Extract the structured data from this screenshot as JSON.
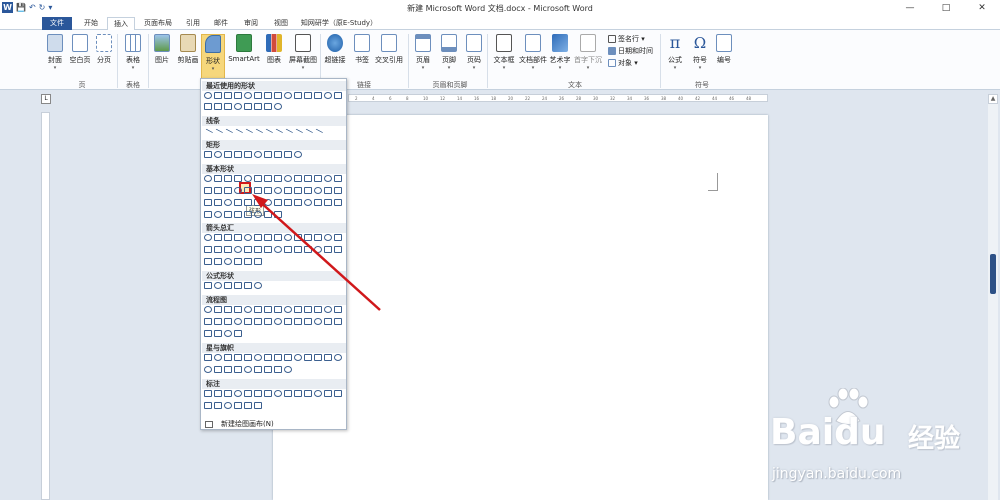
{
  "window": {
    "title": "新建 Microsoft Word 文档.docx - Microsoft Word",
    "minimize": "—",
    "maximize": "□",
    "close": "✕"
  },
  "quick_access": {
    "logo": "W",
    "save": "💾",
    "undo": "↶",
    "redo": "↻",
    "more": "▾"
  },
  "tabs": [
    "文件",
    "开始",
    "插入",
    "页面布局",
    "引用",
    "邮件",
    "审阅",
    "视图",
    "知网研学（原E-Study）"
  ],
  "active_tab": "插入",
  "ribbon": {
    "buttons": {
      "cover": "封面",
      "blank": "空白页",
      "pagebreak": "分页",
      "table": "表格",
      "picture": "图片",
      "clipart": "剪贴画",
      "shapes": "形状",
      "smartart": "SmartArt",
      "chart": "图表",
      "screenshot": "屏幕截图",
      "hyperlink": "超链接",
      "bookmark": "书签",
      "crossref": "交叉引用",
      "header": "页眉",
      "footer": "页脚",
      "pagenum": "页码",
      "textbox": "文本框",
      "docparts": "文档部件",
      "wordart": "艺术字",
      "dropcap": "首字下沉",
      "formula": "公式",
      "symbol": "符号",
      "number": "编号"
    },
    "small": {
      "signature": "签名行",
      "datetime": "日期和时间",
      "object": "对象"
    },
    "groups": {
      "pages": "页",
      "tables": "表格",
      "links": "链接",
      "headerfooter": "页眉和页脚",
      "text": "文本",
      "symbols": "符号"
    }
  },
  "shapes_menu": {
    "sections": [
      "最近使用的形状",
      "线条",
      "矩形",
      "基本形状",
      "箭头总汇",
      "公式形状",
      "流程图",
      "星与旗帜",
      "标注"
    ],
    "tooltip": "弦形",
    "new_canvas": "新建绘图画布(N)"
  },
  "ruler_ticks": [
    "2",
    "4",
    "6",
    "8",
    "10",
    "12",
    "14",
    "16",
    "18",
    "20",
    "22",
    "24",
    "26",
    "28",
    "30",
    "32",
    "34",
    "36",
    "38",
    "40",
    "42",
    "44",
    "46",
    "48"
  ],
  "watermark": {
    "brand": "Bai",
    "mark": "du",
    "cn": "经验",
    "url": "jingyan.baidu.com"
  },
  "colors": {
    "accent": "#2b579a",
    "highlight": "#d0181b",
    "selected_button": "#f6d77c"
  }
}
